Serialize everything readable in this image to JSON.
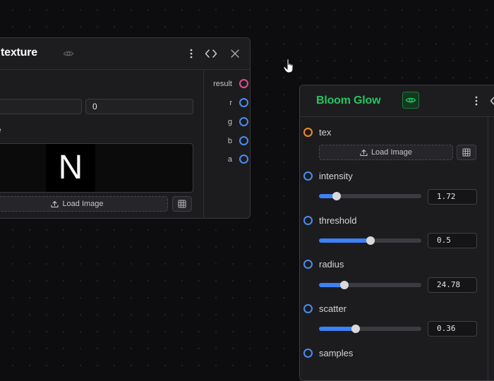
{
  "node_left": {
    "title": "texture",
    "label_fragment": "e",
    "field_value": "0",
    "preview_letter": "N",
    "load_image_label": "Load Image",
    "outputs": [
      "result",
      "r",
      "g",
      "b",
      "a"
    ]
  },
  "node_right": {
    "title": "Bloom Glow",
    "title_color": "#22c55e",
    "tex_label": "tex",
    "load_image_label": "Load Image",
    "params": [
      {
        "label": "intensity",
        "value": "1.72",
        "fraction": 0.17
      },
      {
        "label": "threshold",
        "value": "0.5",
        "fraction": 0.5
      },
      {
        "label": "radius",
        "value": "24.78",
        "fraction": 0.25
      },
      {
        "label": "scatter",
        "value": "0.36",
        "fraction": 0.36
      }
    ],
    "last_label": "samples"
  },
  "colors": {
    "port_blue": "#4a8cf0",
    "port_pink": "#e0508c",
    "port_orange": "#f08a2a",
    "slider_fill": "#3b82f6"
  }
}
